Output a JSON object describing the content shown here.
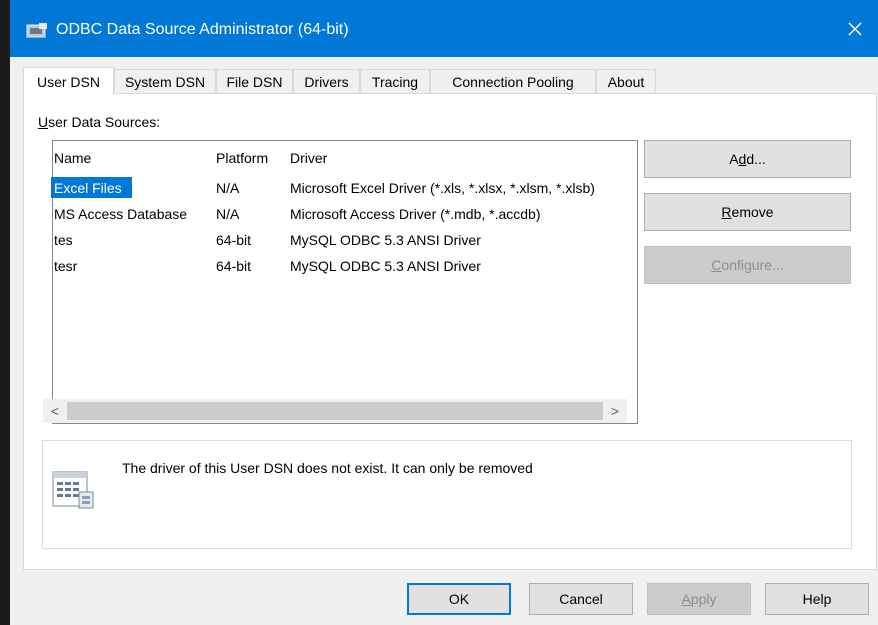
{
  "window": {
    "title": "ODBC Data Source Administrator (64-bit)",
    "close_glyph": "✕"
  },
  "tabs": [
    {
      "label": "User DSN",
      "active": true
    },
    {
      "label": "System DSN"
    },
    {
      "label": "File DSN"
    },
    {
      "label": "Drivers"
    },
    {
      "label": "Tracing"
    },
    {
      "label": "Connection Pooling"
    },
    {
      "label": "About"
    }
  ],
  "section_label": "User Data Sources:",
  "table": {
    "headers": [
      "Name",
      "Platform",
      "Driver"
    ],
    "rows": [
      {
        "name": "Excel Files",
        "platform": "N/A",
        "driver": "Microsoft Excel Driver (*.xls, *.xlsx, *.xlsm, *.xlsb)",
        "selected": true
      },
      {
        "name": "MS Access Database",
        "platform": "N/A",
        "driver": "Microsoft Access Driver (*.mdb, *.accdb)"
      },
      {
        "name": "tes",
        "platform": "64-bit",
        "driver": "MySQL ODBC 5.3 ANSI Driver"
      },
      {
        "name": "tesr",
        "platform": "64-bit",
        "driver": "MySQL ODBC 5.3 ANSI Driver"
      }
    ]
  },
  "scrollbar": {
    "left_glyph": "<",
    "right_glyph": ">"
  },
  "side_buttons": {
    "add": {
      "pre": "A",
      "key": "d",
      "post": "d..."
    },
    "remove": {
      "pre": "",
      "key": "R",
      "post": "emove"
    },
    "configure": {
      "pre": "",
      "key": "C",
      "post": "onfigure...",
      "disabled": true
    }
  },
  "info": {
    "message": "The driver of this User DSN does not exist. It can only be removed"
  },
  "footer": {
    "ok": "OK",
    "cancel": "Cancel",
    "apply": {
      "pre": "",
      "key": "A",
      "post": "pply",
      "disabled": true
    },
    "help": "Help"
  },
  "colors": {
    "accent": "#0078d7",
    "window_bg": "#f0f0f0"
  }
}
